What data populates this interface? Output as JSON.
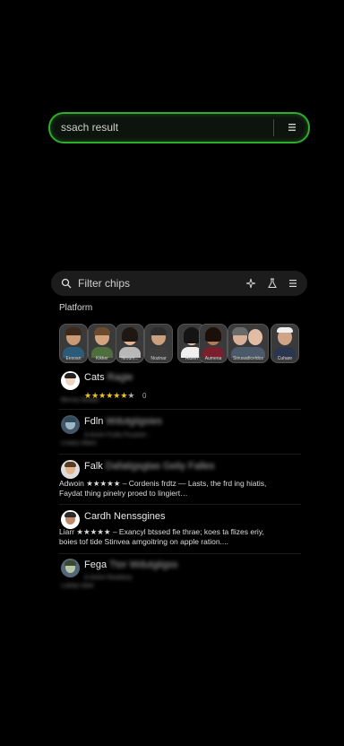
{
  "top_search": {
    "text": "ssach result",
    "menu_icon": "menu-icon"
  },
  "filter_bar": {
    "placeholder": "Filter chips",
    "icons": [
      "search-icon",
      "sparkle-icon",
      "flask-icon",
      "menu-icon"
    ]
  },
  "section_label": "Platform",
  "chips": [
    {
      "caption": "Eesoan",
      "skin": "#c89a76",
      "hair": "#3b2a1c",
      "shirt": "#2c5b7a"
    },
    {
      "caption": "Kikker",
      "skin": "#d3a47f",
      "hair": "#6b4a2e",
      "shirt": "#4f6e3d"
    },
    {
      "caption": "Nroum...",
      "skin": "#e0b593",
      "hair": "#1f1712",
      "shirt": "#b8b8b8"
    },
    {
      "caption": "Nozinar",
      "skin": "#caa07e",
      "hair": "#2d2d2d",
      "shirt": "#3d3d3d"
    },
    {
      "caption": "Aldein",
      "skin": "#e9c7b0",
      "hair": "#141414",
      "shirt": "#f0f0f0"
    },
    {
      "caption": "Aumena",
      "skin": "#b27a55",
      "hair": "#1c0f0a",
      "shirt": "#7a1f2b"
    },
    {
      "caption": "Sinuaadiceldos",
      "skin": "#d7b19a",
      "hair": "#6a6a6a",
      "shirt": "#4a5a6a"
    },
    {
      "caption": "Cuhanr",
      "skin": "#cfa487",
      "hair": "#eeeeee",
      "shirt": "#2a3550"
    }
  ],
  "results": [
    {
      "name": "Cats",
      "name_blur": "Ragie",
      "stars": "★★★★★★",
      "half": "★",
      "rating": "0",
      "meta": "Beoviy Buads",
      "line1": "",
      "line2": "",
      "skin": "#f0d6c2",
      "hair": "#222"
    },
    {
      "name": "Fdln",
      "name_blur": "Wdutgiigsies",
      "stars": "",
      "half": "",
      "rating": "",
      "meta": "A Aviire Fiulla Psuasor  -",
      "line1": "Linaey tdlam",
      "line2": "",
      "skin": "#9ab8c8",
      "hair": "#2d4a5a"
    },
    {
      "name": "Falk",
      "name_blur": "Dafatigsgtas Geliy Falles",
      "stars": "★★★★★",
      "half": "",
      "rating": "",
      "meta": "",
      "line1": "Adwoin  ★★★★★ – Cordenis frdtz — Lasts, the frd ing hiatis,",
      "line2": "Faydat thing pinelry proed to lingiert…",
      "skin": "#e3b58e",
      "hair": "#5a3a22"
    },
    {
      "name": "Cardh",
      "name_blur": "Nenssgines",
      "stars": "★★★★★",
      "half": "",
      "rating": "",
      "meta": "",
      "line1": "Liarr  ★★★★★ – Exancyl btssed fie thrae; koes ta flizes eriy,",
      "line2": "boies tof  tide Stinvea amgoitring on apple ration....",
      "skin": "#c08a6a",
      "hair": "#2b2b2b"
    },
    {
      "name": "Fega",
      "name_blur": "Ttor Wdutgiigss",
      "stars": "",
      "half": "",
      "rating": "",
      "meta": "A Avtire Reallwsy",
      "line1": "Liaday tdad",
      "line2": "",
      "skin": "#b8c9a8",
      "hair": "#3a4a30"
    }
  ]
}
